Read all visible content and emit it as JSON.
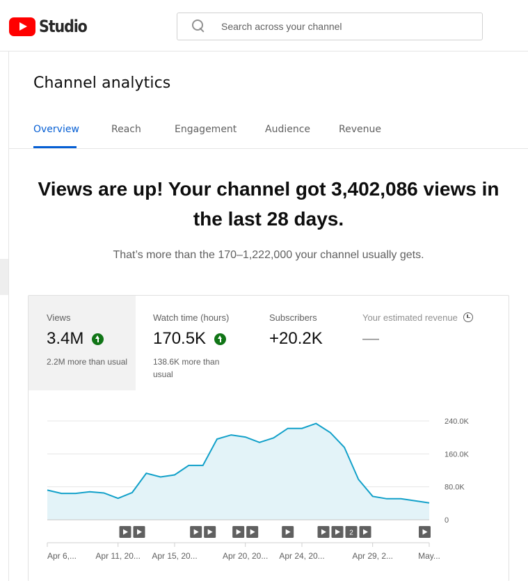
{
  "header": {
    "logo_text": "Studio",
    "search_placeholder": "Search across your channel"
  },
  "page": {
    "title": "Channel analytics",
    "tabs": [
      {
        "label": "Overview",
        "active": true
      },
      {
        "label": "Reach",
        "active": false
      },
      {
        "label": "Engagement",
        "active": false
      },
      {
        "label": "Audience",
        "active": false
      },
      {
        "label": "Revenue",
        "active": false
      }
    ],
    "headline_line1": "Views are up! Your channel got 3,402,086 views in",
    "headline_line2": "the last 28 days.",
    "subline": "That’s more than the 170–1,222,000 your channel usually gets."
  },
  "metrics": [
    {
      "label": "Views",
      "value": "3.4M",
      "trend": "up",
      "note": "2.2M more than usual",
      "selected": true
    },
    {
      "label": "Watch time (hours)",
      "value": "170.5K",
      "trend": "up",
      "note": "138.6K more than usual",
      "selected": false
    },
    {
      "label": "Subscribers",
      "value": "+20.2K",
      "trend": "",
      "note": "",
      "selected": false
    },
    {
      "label": "Your estimated revenue",
      "value": "—",
      "trend": "",
      "note": "",
      "selected": false
    }
  ],
  "chart_data": {
    "type": "area",
    "series": [
      {
        "values": [
          72000,
          64000,
          64000,
          68000,
          65000,
          52000,
          66000,
          113000,
          104000,
          109000,
          132000,
          132000,
          196000,
          206000,
          201000,
          188000,
          199000,
          222000,
          222000,
          234000,
          212000,
          176000,
          98000,
          57000,
          51000,
          51000,
          46000,
          41000
        ]
      }
    ],
    "x_labels": [
      "Apr 6,...",
      "Apr 11, 20...",
      "Apr 15, 20...",
      "Apr 20, 20...",
      "Apr 24, 20...",
      "Apr 29, 2...",
      "May..."
    ],
    "y_ticks": [
      {
        "value": 240000,
        "label": "240.0K"
      },
      {
        "value": 160000,
        "label": "160.0K"
      },
      {
        "value": 80000,
        "label": "80.0K"
      },
      {
        "value": 0,
        "label": "0"
      }
    ],
    "ylim": [
      0,
      240000
    ],
    "grid": true,
    "color": "#11a0c9",
    "fill": "#e3f3f8",
    "markers": [
      {
        "day": 6,
        "items": [
          "play",
          "play"
        ]
      },
      {
        "day": 11,
        "items": [
          "play",
          "play"
        ]
      },
      {
        "day": 14,
        "items": [
          "play",
          "play"
        ]
      },
      {
        "day": 17,
        "items": [
          "play"
        ]
      },
      {
        "day": 21,
        "items": [
          "play",
          "play",
          "2",
          "play"
        ]
      },
      {
        "day": 27,
        "items": [
          "play"
        ]
      }
    ]
  }
}
